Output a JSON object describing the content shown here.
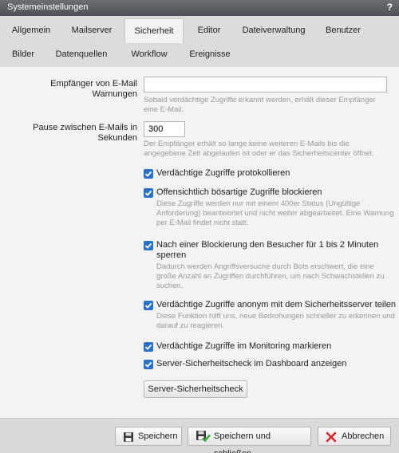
{
  "window": {
    "title": "Systemeinstellungen",
    "help": "?"
  },
  "tabs": {
    "row1": [
      "Allgemein",
      "Mailserver",
      "Sicherheit",
      "Editor",
      "Dateiverwaltung",
      "Benutzer"
    ],
    "row2": [
      "Bilder",
      "Datenquellen",
      "Workflow",
      "Ereignisse"
    ],
    "active": "Sicherheit"
  },
  "form": {
    "email_label": "Empfänger von E-Mail Warnungen",
    "email_value": "",
    "email_help": "Sobald verdächtige Zugriffe erkannt werden, erhält dieser Empfänger eine E-Mail.",
    "pause_label": "Pause zwischen E-Mails in Sekunden",
    "pause_value": "300",
    "pause_help": "Der Empfänger erhält so lange keine weiteren E-Mails bis die angegebene Zeit abgelaufen ist oder er das Sicherheitscenter öffnet.",
    "checkboxes": [
      {
        "label": "Verdächtige Zugriffe protokollieren",
        "help": "",
        "checked": true
      },
      {
        "label": "Offensichtlich bösartige Zugriffe blockieren",
        "help": "Diese Zugriffe werden nur mit einem 400er Status (Ungültige Anforderung) beantwortet und nicht weiter abgearbeitet. Eine Warnung per E-Mail findet nicht statt.",
        "checked": true
      },
      {
        "label": "Nach einer Blockierung den Besucher für 1 bis 2 Minuten sperren",
        "help": "Dadurch werden Angriffsversuche durch Bots erschwert, die eine große Anzahl an Zugriffen durchführen, um nach Schwachstellen zu suchen.",
        "checked": true
      },
      {
        "label": "Verdächtige Zugriffe anonym mit dem Sicherheitsserver teilen",
        "help": "Diese Funktion hilft uns, neue Bedrohungen schneller zu erkennen und darauf zu reagieren.",
        "checked": true
      },
      {
        "label": "Verdächtige Zugriffe im Monitoring markieren",
        "help": "",
        "checked": true
      },
      {
        "label": "Server-Sicherheitscheck im Dashboard anzeigen",
        "help": "",
        "checked": true
      }
    ],
    "check_button": "Server-Sicherheitscheck"
  },
  "footer": {
    "save": "Speichern",
    "save_close": "Speichern und schließen",
    "cancel": "Abbrechen"
  },
  "icons": {
    "checkbox_color": "#2a72c9",
    "save": "floppy-disk-icon",
    "save_close": "floppy-disk-check-icon",
    "cancel": "red-x-icon"
  }
}
